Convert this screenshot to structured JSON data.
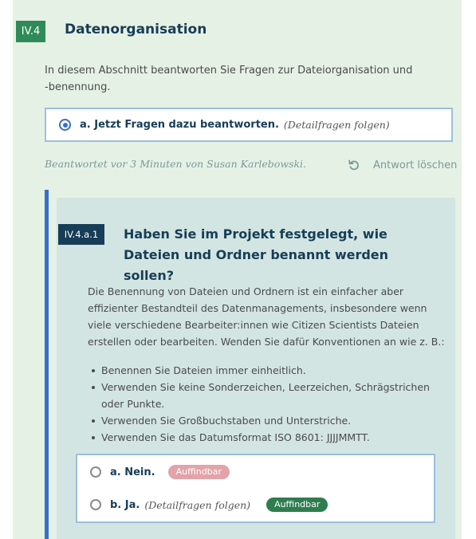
{
  "section": {
    "number": "IV.4",
    "title": "Datenorganisation",
    "intro": "In diesem Abschnitt beantworten Sie Fragen zur Dateiorganisation und -benennung."
  },
  "selected_answer": {
    "label": "a. Jetzt Fragen dazu beantworten.",
    "note": "(Detailfragen folgen)"
  },
  "answer_meta": {
    "answered_by": "Beantwortet vor 3 Minuten von Susan Karlebowski.",
    "delete_label": "Antwort löschen",
    "delete_icon": "undo-icon"
  },
  "subquestion": {
    "number": "IV.4.a.1",
    "title": "Haben Sie im Projekt festgelegt, wie Dateien und Ordner benannt werden sollen?",
    "description": "Die Benennung von Dateien und Ordnern ist ein einfacher aber effizienter Bestandteil des Datenmanagements, insbesondere wenn viele verschiedene Bearbeiter:innen wie Citizen Scientists Dateien erstellen oder bearbeiten. Wenden Sie dafür Konventionen an wie z. B.:",
    "rules": [
      "Benennen Sie Dateien immer einheitlich.",
      "Verwenden Sie keine Sonderzeichen, Leerzeichen, Schrägstrichen oder Punkte.",
      "Verwenden Sie Großbuchstaben und Unterstriche.",
      "Verwenden Sie das Datumsformat ISO 8601: JJJJMMTT."
    ],
    "options": [
      {
        "label": "a. Nein.",
        "note": "",
        "tag": "Auffindbar",
        "tag_style": "muted",
        "selected": false
      },
      {
        "label": "b. Ja.",
        "note": "(Detailfragen folgen)",
        "tag": "Auffindbar",
        "tag_style": "strong",
        "selected": false
      }
    ]
  },
  "colors": {
    "section_badge": "#2e8b57",
    "title": "#173d57",
    "accent_blue": "#3a6fc9",
    "panel_bg": "#e6f1e6",
    "card_bg": "#d3e5e2"
  }
}
